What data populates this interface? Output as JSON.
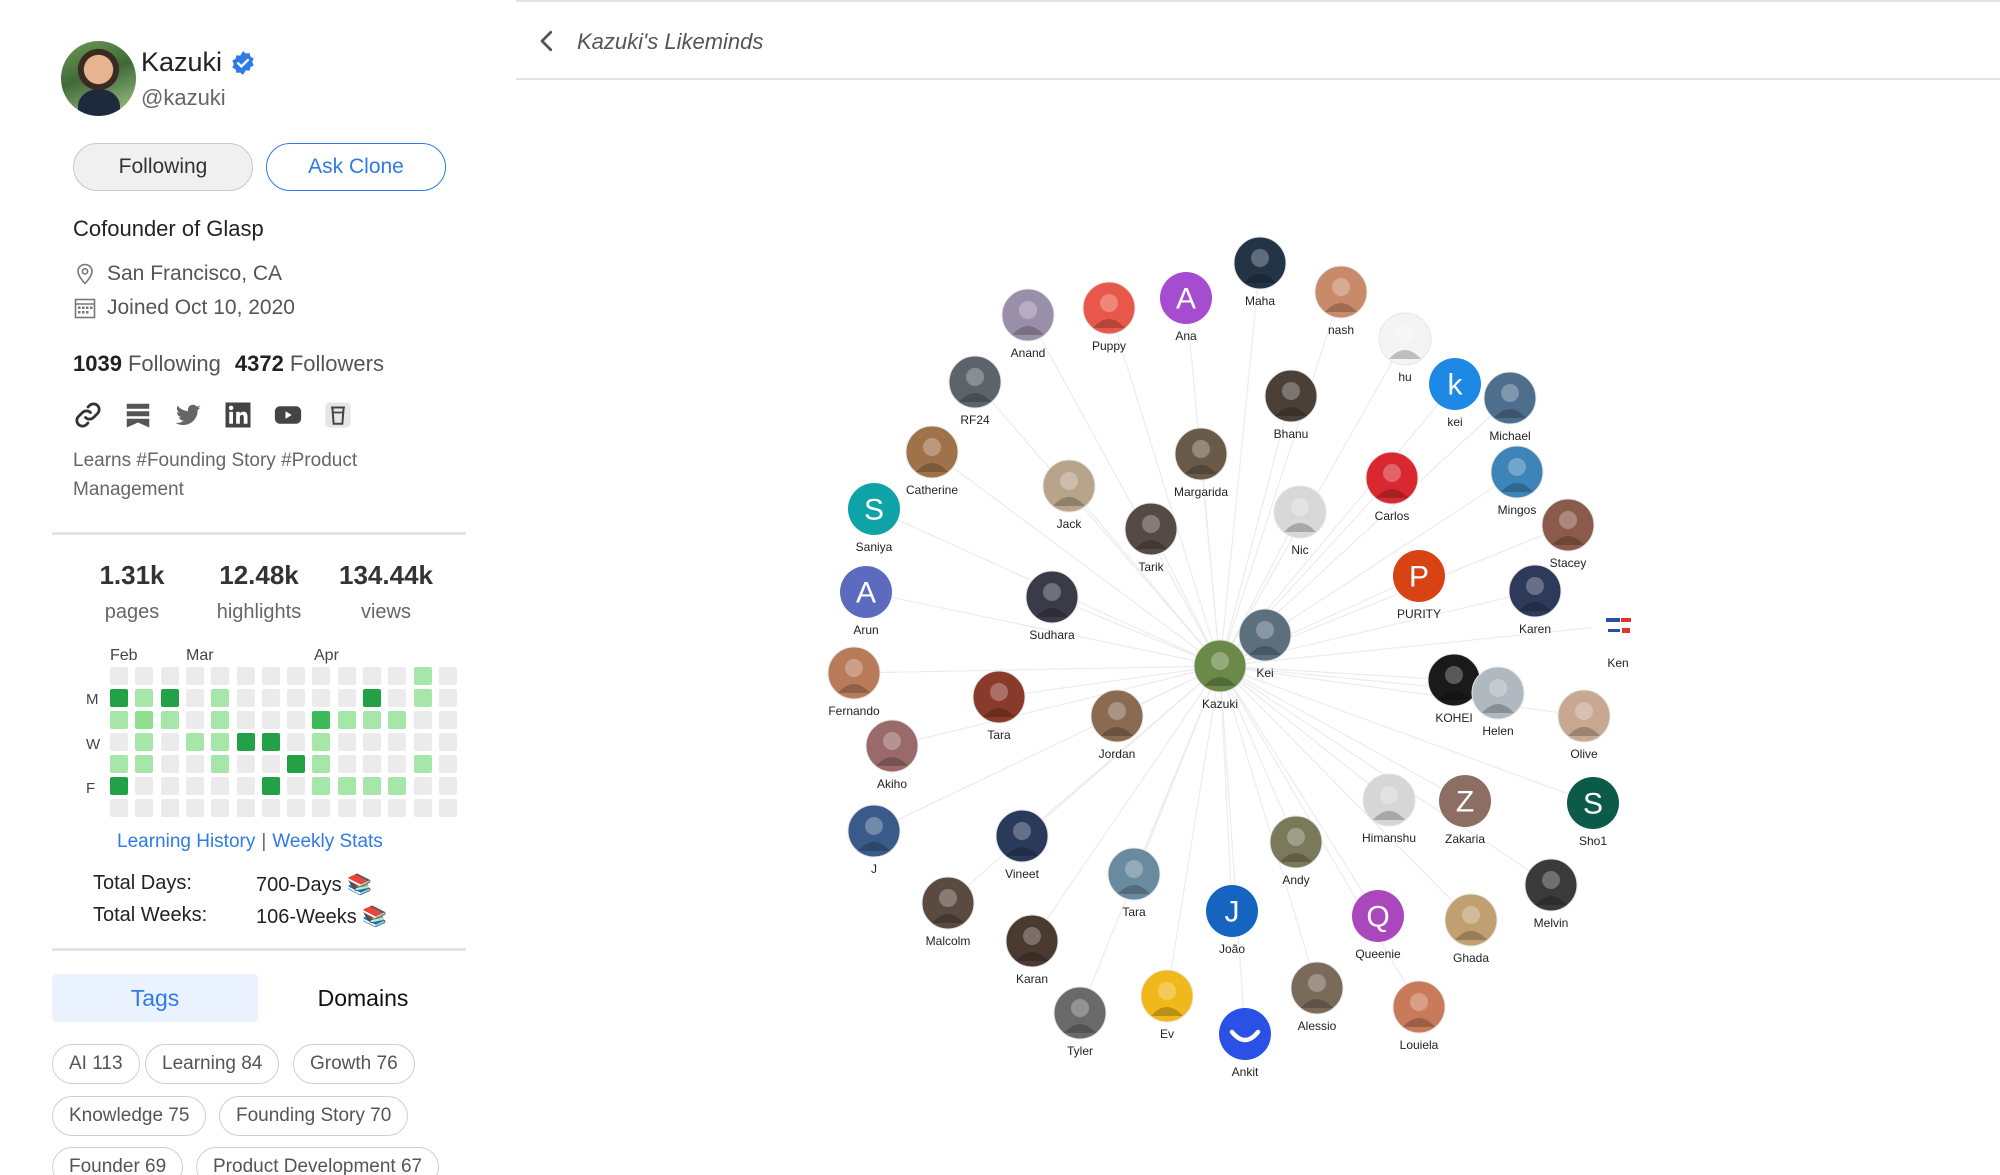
{
  "profile": {
    "name": "Kazuki",
    "handle": "@kazuki",
    "bio": "Cofounder of Glasp",
    "location": "San Francisco, CA",
    "joined": "Joined Oct 10, 2020",
    "following_count": "1039",
    "following_label": "Following",
    "followers_count": "4372",
    "followers_label": "Followers",
    "learns": "Learns #Founding Story #Product Management"
  },
  "buttons": {
    "following": "Following",
    "ask_clone": "Ask Clone"
  },
  "social_icons": [
    "link-icon",
    "glasp-icon",
    "twitter-icon",
    "linkedin-icon",
    "youtube-icon",
    "cup-icon"
  ],
  "stats": [
    {
      "value": "1.31k",
      "label": "pages"
    },
    {
      "value": "12.48k",
      "label": "highlights"
    },
    {
      "value": "134.44k",
      "label": "views"
    }
  ],
  "heatmap": {
    "months": [
      "Feb",
      "Mar",
      "Apr"
    ],
    "days": [
      "M",
      "W",
      "F"
    ],
    "cols": [
      [
        0,
        4,
        1,
        0,
        1,
        4,
        0
      ],
      [
        0,
        1,
        2,
        1,
        1,
        0,
        0
      ],
      [
        0,
        4,
        1,
        0,
        0,
        0,
        0
      ],
      [
        0,
        0,
        0,
        1,
        0,
        0,
        0
      ],
      [
        0,
        1,
        1,
        1,
        1,
        0,
        0
      ],
      [
        0,
        0,
        0,
        4,
        0,
        0,
        0
      ],
      [
        0,
        0,
        0,
        4,
        0,
        4,
        0
      ],
      [
        0,
        0,
        0,
        0,
        4,
        0,
        0
      ],
      [
        0,
        0,
        3,
        1,
        1,
        1,
        0
      ],
      [
        0,
        0,
        1,
        0,
        0,
        1,
        0
      ],
      [
        0,
        4,
        1,
        0,
        0,
        1,
        0
      ],
      [
        0,
        0,
        1,
        0,
        0,
        1,
        0
      ],
      [
        1,
        1,
        0,
        0,
        1,
        0,
        0
      ],
      [
        0,
        0,
        0,
        0,
        0,
        0,
        0
      ]
    ]
  },
  "history": {
    "learning_history": "Learning History",
    "separator": "|",
    "weekly_stats": "Weekly Stats"
  },
  "totals": {
    "days_label": "Total Days:",
    "days_value": "700-Days 📚",
    "weeks_label": "Total Weeks:",
    "weeks_value": "106-Weeks 📚"
  },
  "tabs": {
    "tags": "Tags",
    "domains": "Domains"
  },
  "tags": [
    "AI 113",
    "Learning 84",
    "Growth 76",
    "Knowledge 75",
    "Founding Story 70",
    "Founder 69",
    "Product Development 67"
  ],
  "main": {
    "title": "Kazuki's Likeminds"
  },
  "graph": {
    "center": "Kazuki",
    "nodes": [
      {
        "name": "Kazuki",
        "style": "photo",
        "color": "#6b8a4a"
      },
      {
        "name": "Kei",
        "style": "photo",
        "color": "#5b6f7d"
      },
      {
        "name": "Maha",
        "style": "photo",
        "color": "#243447"
      },
      {
        "name": "nash",
        "style": "photo",
        "color": "#c88a6a"
      },
      {
        "name": "Ana",
        "style": "letter",
        "letter": "A",
        "color": "#a64cd0"
      },
      {
        "name": "Puppy",
        "style": "photo",
        "color": "#e8584a"
      },
      {
        "name": "Anand",
        "style": "photo",
        "color": "#9a8fa8"
      },
      {
        "name": "RF24",
        "style": "photo",
        "color": "#5d636a"
      },
      {
        "name": "hu",
        "style": "photo",
        "color": "#f4f4f4"
      },
      {
        "name": "kei",
        "style": "letter",
        "letter": "k",
        "color": "#1e88e5"
      },
      {
        "name": "Michael",
        "style": "photo",
        "color": "#4e6e8e"
      },
      {
        "name": "Bhanu",
        "style": "photo",
        "color": "#4a4038"
      },
      {
        "name": "Margarida",
        "style": "photo",
        "color": "#6a5a48"
      },
      {
        "name": "Catherine",
        "style": "photo",
        "color": "#a0724a"
      },
      {
        "name": "Jack",
        "style": "photo",
        "color": "#b8a48a"
      },
      {
        "name": "Tarik",
        "style": "photo",
        "color": "#554a45"
      },
      {
        "name": "Nic",
        "style": "photo",
        "color": "#d8d8d8"
      },
      {
        "name": "Carlos",
        "style": "photo",
        "color": "#d9282f"
      },
      {
        "name": "Mingos",
        "style": "photo",
        "color": "#3d84b8"
      },
      {
        "name": "Stacey",
        "style": "photo",
        "color": "#8a5a4a"
      },
      {
        "name": "Saniya",
        "style": "letter",
        "letter": "S",
        "color": "#0fa3a8"
      },
      {
        "name": "Arun",
        "style": "letter",
        "letter": "A",
        "color": "#5c6bc0"
      },
      {
        "name": "Sudhara",
        "style": "photo",
        "color": "#3a3a48"
      },
      {
        "name": "PURITY",
        "style": "letter",
        "letter": "P",
        "color": "#d84315"
      },
      {
        "name": "Karen",
        "style": "photo",
        "color": "#2e3a5a"
      },
      {
        "name": "Ken",
        "style": "logo",
        "color": "#ffffff"
      },
      {
        "name": "Fernando",
        "style": "photo",
        "color": "#b97a5a"
      },
      {
        "name": "Tara",
        "style": "photo",
        "color": "#8a3a2a"
      },
      {
        "name": "Jordan",
        "style": "photo",
        "color": "#8a6a50"
      },
      {
        "name": "KOHEI",
        "style": "photo",
        "color": "#1a1a1a"
      },
      {
        "name": "Helen",
        "style": "photo",
        "color": "#b0b8c0"
      },
      {
        "name": "Olive",
        "style": "photo",
        "color": "#c8a890"
      },
      {
        "name": "Akiho",
        "style": "photo",
        "color": "#9a6a6a"
      },
      {
        "name": "J",
        "style": "photo",
        "color": "#3a5a8a"
      },
      {
        "name": "Vineet",
        "style": "photo",
        "color": "#2a3a5a"
      },
      {
        "name": "Tara",
        "style": "photo",
        "color": "#6a8aa0"
      },
      {
        "name": "Andy",
        "style": "photo",
        "color": "#7a7a5a"
      },
      {
        "name": "Himanshu",
        "style": "photo",
        "color": "#d6d6d6"
      },
      {
        "name": "Zakaria",
        "style": "letter",
        "letter": "Z",
        "color": "#8d6e63"
      },
      {
        "name": "Sho1",
        "style": "letter",
        "letter": "S",
        "color": "#0b5a4a"
      },
      {
        "name": "Malcolm",
        "style": "photo",
        "color": "#5a4a40"
      },
      {
        "name": "Karan",
        "style": "photo",
        "color": "#4a3a30"
      },
      {
        "name": "João",
        "style": "letter",
        "letter": "J",
        "color": "#1565c0"
      },
      {
        "name": "Queenie",
        "style": "letter",
        "letter": "Q",
        "color": "#ab47bc"
      },
      {
        "name": "Ghada",
        "style": "photo",
        "color": "#c0a070"
      },
      {
        "name": "Melvin",
        "style": "photo",
        "color": "#3a3a3a"
      },
      {
        "name": "Tyler",
        "style": "photo",
        "color": "#6a6a6a"
      },
      {
        "name": "Ev",
        "style": "photo",
        "color": "#f0b81a"
      },
      {
        "name": "Alessio",
        "style": "photo",
        "color": "#7a6a5a"
      },
      {
        "name": "Louiela",
        "style": "photo",
        "color": "#c87a5a"
      },
      {
        "name": "Ankit",
        "style": "smile",
        "color": "#2b50e6"
      }
    ]
  }
}
